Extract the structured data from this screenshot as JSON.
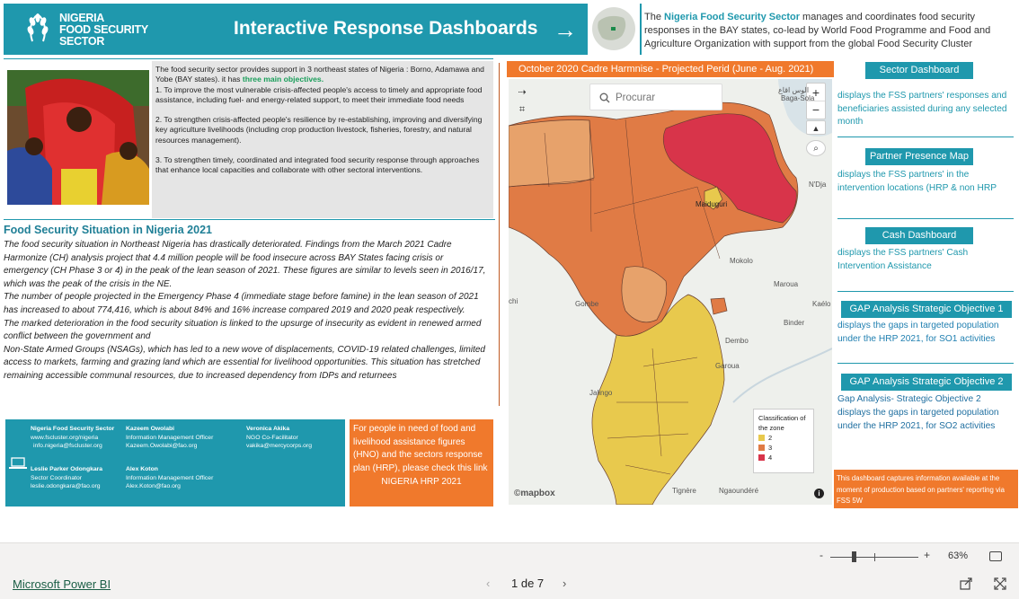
{
  "header": {
    "logo_lines": [
      "NIGERIA",
      "FOOD SECURITY",
      "SECTOR"
    ],
    "title": "Interactive Response Dashboards",
    "desc_pre": "The ",
    "desc_highlight": "Nigeria  Food Security Sector",
    "desc_post": " manages and coordinates food security responses in the BAY states, co-lead by World Food Programme and Food and Agriculture Organization with support from the global Food Security Cluster"
  },
  "intro": {
    "p1_pre": "The food security sector provides support in 3 northeast states of Nigeria : Borno, Adamawa and Yobe (BAY states). it has ",
    "p1_highlight": "three main objectives.",
    "obj1": "1. To improve the most vulnerable crisis-affected people's access to timely and appropriate food",
    "obj1b": "assistance, including fuel- and energy-related support, to meet their immediate food needs",
    "obj2": "2. To strengthen crisis-affected people's resilience by re-establishing, improving and diversifying key agriculture livelihoods (including crop production livestock, fisheries, forestry, and natural resources management).",
    "obj3": "3.  To strengthen timely, coordinated and integrated food security response through approaches that enhance local capacities and collaborate with other sectoral interventions."
  },
  "situation": {
    "title": "Food Security Situation in Nigeria 2021",
    "body": [
      "The food security situation in Northeast Nigeria has drastically deteriorated. Findings from the March 2021 Cadre Harmonize (CH) analysis project that 4.4 million people will be food insecure across BAY States facing crisis or emergency (CH Phase 3 or 4) in the peak of the lean season of 2021. These figures are similar to levels seen in 2016/17, which was the peak of the crisis in the NE.",
      "The number of people projected in the Emergency Phase 4 (immediate stage before famine) in the lean season of 2021 has increased to about 774,416, which is about 84% and 16% increase compared 2019 and 2020 peak respectively.",
      "The marked deterioration in the food security situation is linked to the upsurge of insecurity as evident in renewed armed conflict between the government and",
      "Non-State Armed Groups (NSAGs), which has led to a new wove of  displacements, COVID-19 related challenges, limited access to markets, farming and grazing land which are essential for livelihood opportunities. This situation has stretched remaining accessible communal resources, due to increased dependency from IDPs and returnees"
    ]
  },
  "contacts": {
    "c1": [
      "Nigeria Food Security Sector",
      "www.fscluster.org/nigeria",
      "info.nigeria@fscluster.org"
    ],
    "c2": [
      "Kazeem Owolabi",
      "Information Management Officer",
      "Kazeem.Owolabi@fao.org"
    ],
    "c3": [
      "Veronica Akika",
      "NGO Co-Facilitator",
      "vakika@mercycorps.org"
    ],
    "c4": [
      "Leslie Parker Odongkara",
      "Sector Coordinator",
      "leslie.odongkara@fao.org"
    ],
    "c5": [
      "Alex Koton",
      "Information Management Officer",
      "Alex.Koton@fao.org"
    ]
  },
  "hrp": {
    "text": "For people in need of food and livelihood assistance figures (HNO) and the sectors response plan (HRP), please check this link",
    "link": "NIGERIA HRP 2021"
  },
  "map": {
    "title": "October 2020 Cadre Harmnise - Projected Perid (June - Aug. 2021)",
    "search_placeholder": "Procurar",
    "zoom_in": "+",
    "zoom_out": "−",
    "compass": "▲",
    "attribution": "©mapbox",
    "info": "i",
    "legend_title": "Classification of the zone",
    "legend": [
      {
        "label": "2",
        "color": "#e8c94d"
      },
      {
        "label": "3",
        "color": "#e07b45"
      },
      {
        "label": "4",
        "color": "#d8344a"
      }
    ],
    "places": {
      "baga_arabic": "الوس اقاع",
      "baga": "Baga-Sola",
      "ndja": "N'Dja",
      "maiduguri": "Maiduguri",
      "mokolo": "Mokolo",
      "marqua": "Maroua",
      "kaelo": "Kaélo",
      "gombe": "Gombe",
      "binder": "Binder",
      "dembo": "Dembo",
      "garoua": "Garoua",
      "jalingo": "Jalingo",
      "tignere": "Tignère",
      "ngaoundere": "Ngaoundéré",
      "chi": "chi"
    }
  },
  "right": {
    "b1": "Sector Dashboard",
    "d1": "displays the FSS partners' responses and beneficiaries assisted during any selected month",
    "b2": "Partner Presence Map",
    "d2": "displays the FSS partners' in the intervention locations (HRP & non HRP",
    "b3": "Cash Dashboard",
    "d3": "displays the FSS partners' Cash Intervention Assistance",
    "b4": "GAP Analysis Strategic Objective 1",
    "d4": "displays the gaps in targeted population under the HRP 2021, for SO1 activities",
    "b5": "GAP Analysis Strategic Objective 2",
    "d5a": "Gap Analysis- Strategic Objective 2",
    "d5": "displays the gaps in targeted population under the HRP 2021, for SO2 activities",
    "note": "This dashboard captures information available at the moment of production based on partners' reporting via FSS 5W"
  },
  "statusbar": {
    "zoom_minus": "-",
    "zoom_plus": "+",
    "zoom_pct": "63%",
    "zoom_value": 0.63
  },
  "footer": {
    "pbi": "Microsoft Power BI",
    "prev": "‹",
    "page": "1 de 7",
    "next": "›"
  },
  "colors": {
    "teal": "#1f98ad",
    "orange": "#f0792c",
    "phase2": "#e8c94d",
    "phase3": "#e07b45",
    "phase4": "#d8344a"
  }
}
